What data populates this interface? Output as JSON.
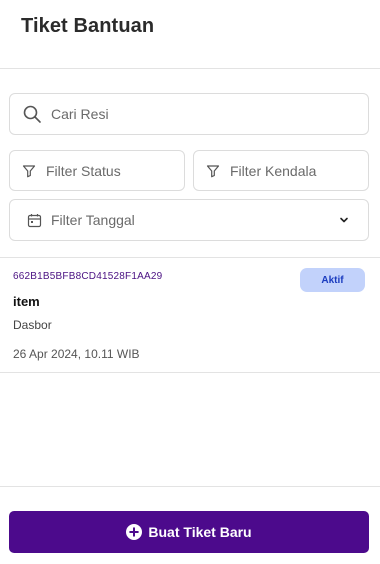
{
  "header": {
    "title": "Tiket Bantuan"
  },
  "search": {
    "placeholder": "Cari Resi",
    "icon": "search-icon"
  },
  "filters": {
    "status_label": "Filter Status",
    "kendala_label": "Filter Kendala",
    "tanggal_label": "Filter Tanggal",
    "filter_icon": "funnel-icon",
    "calendar_icon": "calendar-icon",
    "chevron_icon": "chevron-down-icon"
  },
  "tickets": [
    {
      "id": "662B1B5BFB8CD41528F1AA29",
      "status": "Aktif",
      "title": "item",
      "category": "Dasbor",
      "date": "26 Apr 2024, 10.11 WIB"
    }
  ],
  "footer": {
    "create_label": "Buat Tiket Baru",
    "icon": "plus-circle-icon"
  },
  "colors": {
    "primary": "#4c0a8c",
    "badge_bg": "#c2d2fb",
    "badge_text": "#1a3bbf",
    "ticket_id": "#4a1182"
  }
}
